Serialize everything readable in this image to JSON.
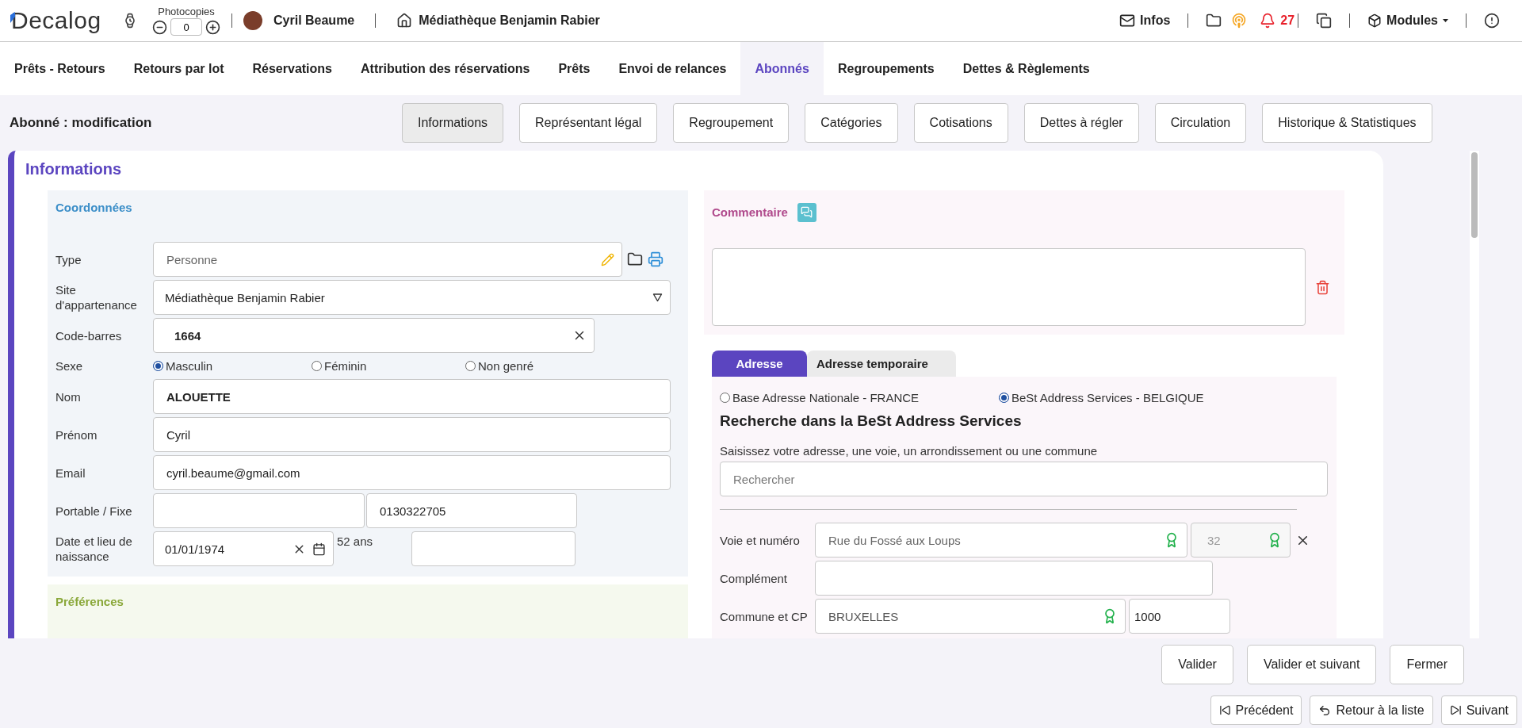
{
  "header": {
    "logo": "Decalog",
    "photocopies": {
      "label": "Photocopies",
      "value": "0"
    },
    "user": "Cyril Beaume",
    "site": "Médiathèque Benjamin Rabier",
    "infos": "Infos",
    "notifications": "27",
    "modules": "Modules"
  },
  "nav": [
    {
      "label": "Prêts - Retours",
      "selected": false
    },
    {
      "label": "Retours par lot",
      "selected": false
    },
    {
      "label": "Réservations",
      "selected": false
    },
    {
      "label": "Attribution des réservations",
      "selected": false
    },
    {
      "label": "Prêts",
      "selected": false
    },
    {
      "label": "Envoi de relances",
      "selected": false
    },
    {
      "label": "Abonnés",
      "selected": true
    },
    {
      "label": "Regroupements",
      "selected": false
    },
    {
      "label": "Dettes & Règlements",
      "selected": false
    }
  ],
  "page_title": "Abonné : modification",
  "subtabs": [
    {
      "label": "Informations",
      "selected": true
    },
    {
      "label": "Représentant légal",
      "selected": false
    },
    {
      "label": "Regroupement",
      "selected": false
    },
    {
      "label": "Catégories",
      "selected": false
    },
    {
      "label": "Cotisations",
      "selected": false
    },
    {
      "label": "Dettes à régler",
      "selected": false
    },
    {
      "label": "Circulation",
      "selected": false
    },
    {
      "label": "Historique & Statistiques",
      "selected": false
    }
  ],
  "section_title": "Informations",
  "coordonnees": {
    "title": "Coordonnées",
    "fields": [
      {
        "kind": "type",
        "label": "Type",
        "value": "Personne"
      },
      {
        "kind": "select",
        "label": "Site d'appartenance",
        "value": "Médiathèque Benjamin Rabier"
      },
      {
        "kind": "barcode",
        "label": "Code-barres",
        "value": "1664"
      },
      {
        "kind": "radio",
        "label": "Sexe",
        "options": [
          {
            "label": "Masculin",
            "selected": true
          },
          {
            "label": "Féminin",
            "selected": false
          },
          {
            "label": "Non genré",
            "selected": false
          }
        ]
      },
      {
        "kind": "strong",
        "label": "Nom",
        "value": "ALOUETTE"
      },
      {
        "kind": "text",
        "label": "Prénom",
        "value": "Cyril"
      },
      {
        "kind": "text",
        "label": "Email",
        "value": "cyril.beaume@gmail.com"
      },
      {
        "kind": "phones",
        "label": "Portable / Fixe",
        "fixed": "0130322705"
      },
      {
        "kind": "birth",
        "label": "Date et lieu de naissance",
        "date": "01/01/1974",
        "age": "52 ans"
      }
    ]
  },
  "preferences": {
    "title": "Préférences"
  },
  "comment": {
    "title": "Commentaire"
  },
  "address": {
    "tabs": [
      {
        "label": "Adresse",
        "selected": true
      },
      {
        "label": "Adresse temporaire",
        "selected": false
      }
    ],
    "sources": [
      {
        "label": "Base Adresse Nationale - FRANCE",
        "selected": false
      },
      {
        "label": "BeSt Address Services - BELGIQUE",
        "selected": true
      }
    ],
    "heading": "Recherche dans la BeSt Address Services",
    "hint": "Saisissez votre adresse, une voie, un arrondissement ou une commune",
    "search_placeholder": "Rechercher",
    "street": {
      "label": "Voie et numéro",
      "value": "Rue du Fossé aux Loups",
      "number": "32"
    },
    "complement": {
      "label": "Complément"
    },
    "city": {
      "label": "Commune et CP",
      "value": "BRUXELLES",
      "postcode": "1000"
    }
  },
  "actions": [
    "Valider",
    "Valider et suivant",
    "Fermer"
  ],
  "navigation": [
    {
      "kind": "previous",
      "label": "Précédent"
    },
    {
      "kind": "back",
      "label": "Retour à la liste"
    },
    {
      "kind": "next",
      "label": "Suivant"
    }
  ]
}
